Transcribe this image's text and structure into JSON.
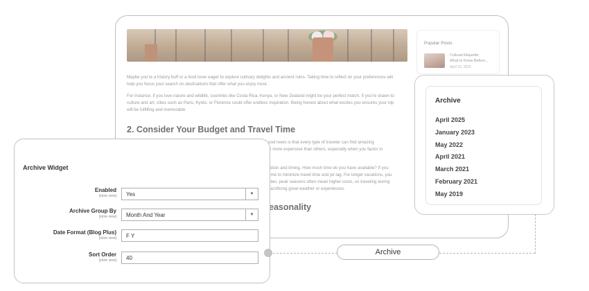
{
  "blog": {
    "paragraph_1": "Maybe you’re a history buff or a food lover eager to explore culinary delights and ancient ruins. Taking time to reflect on your preferences will help you focus your search on destinations that offer what you enjoy most.",
    "paragraph_2": "For instance, if you love nature and wildlife, countries like Costa Rica, Kenya, or New Zealand might be your perfect match. If you’re drawn to culture and art, cities such as Paris, Kyoto, or Florence could offer endless inspiration. Being honest about what excites you ensures your trip will be fulfilling and memorable.",
    "heading_2": "2. Consider Your Budget and Travel Time",
    "paragraph_3_line_1": "ood news is that every type of traveler can find amazing",
    "paragraph_3_line_2": "ly more expensive than others, especially when you factor in",
    "paragraph_4_line_1": "ration and timing. How much time do you have available? If you",
    "paragraph_4_line_2": "ome to minimize travel time and jet lag. For longer vacations, you",
    "paragraph_4_line_3": "nber, peak seasons often mean higher costs, so traveling during",
    "paragraph_4_line_4": "sacrificing great weather or experiences.",
    "heading_3_fragment": "easonality",
    "popular": {
      "title": "Popular Posts",
      "post_title_line_1": "Cultural Etiquette:",
      "post_title_line_2": "What to Know Before...",
      "post_date": "April 15, 2025"
    }
  },
  "archive": {
    "title": "Archive",
    "items": [
      "April 2025",
      "January 2023",
      "May 2022",
      "April 2021",
      "March 2021",
      "February 2021",
      "May 2019"
    ]
  },
  "widget": {
    "title": "Archive Widget",
    "scope_label": "[store view]",
    "fields": {
      "enabled": {
        "label": "Enabled",
        "value": "Yes"
      },
      "group_by": {
        "label": "Archive Group By",
        "value": "Month And Year"
      },
      "date_format": {
        "label": "Date Format (Blog Plus)",
        "value": "F Y"
      },
      "sort_order": {
        "label": "Sort Order",
        "value": "40"
      }
    }
  },
  "callout": {
    "label": "Archive"
  }
}
